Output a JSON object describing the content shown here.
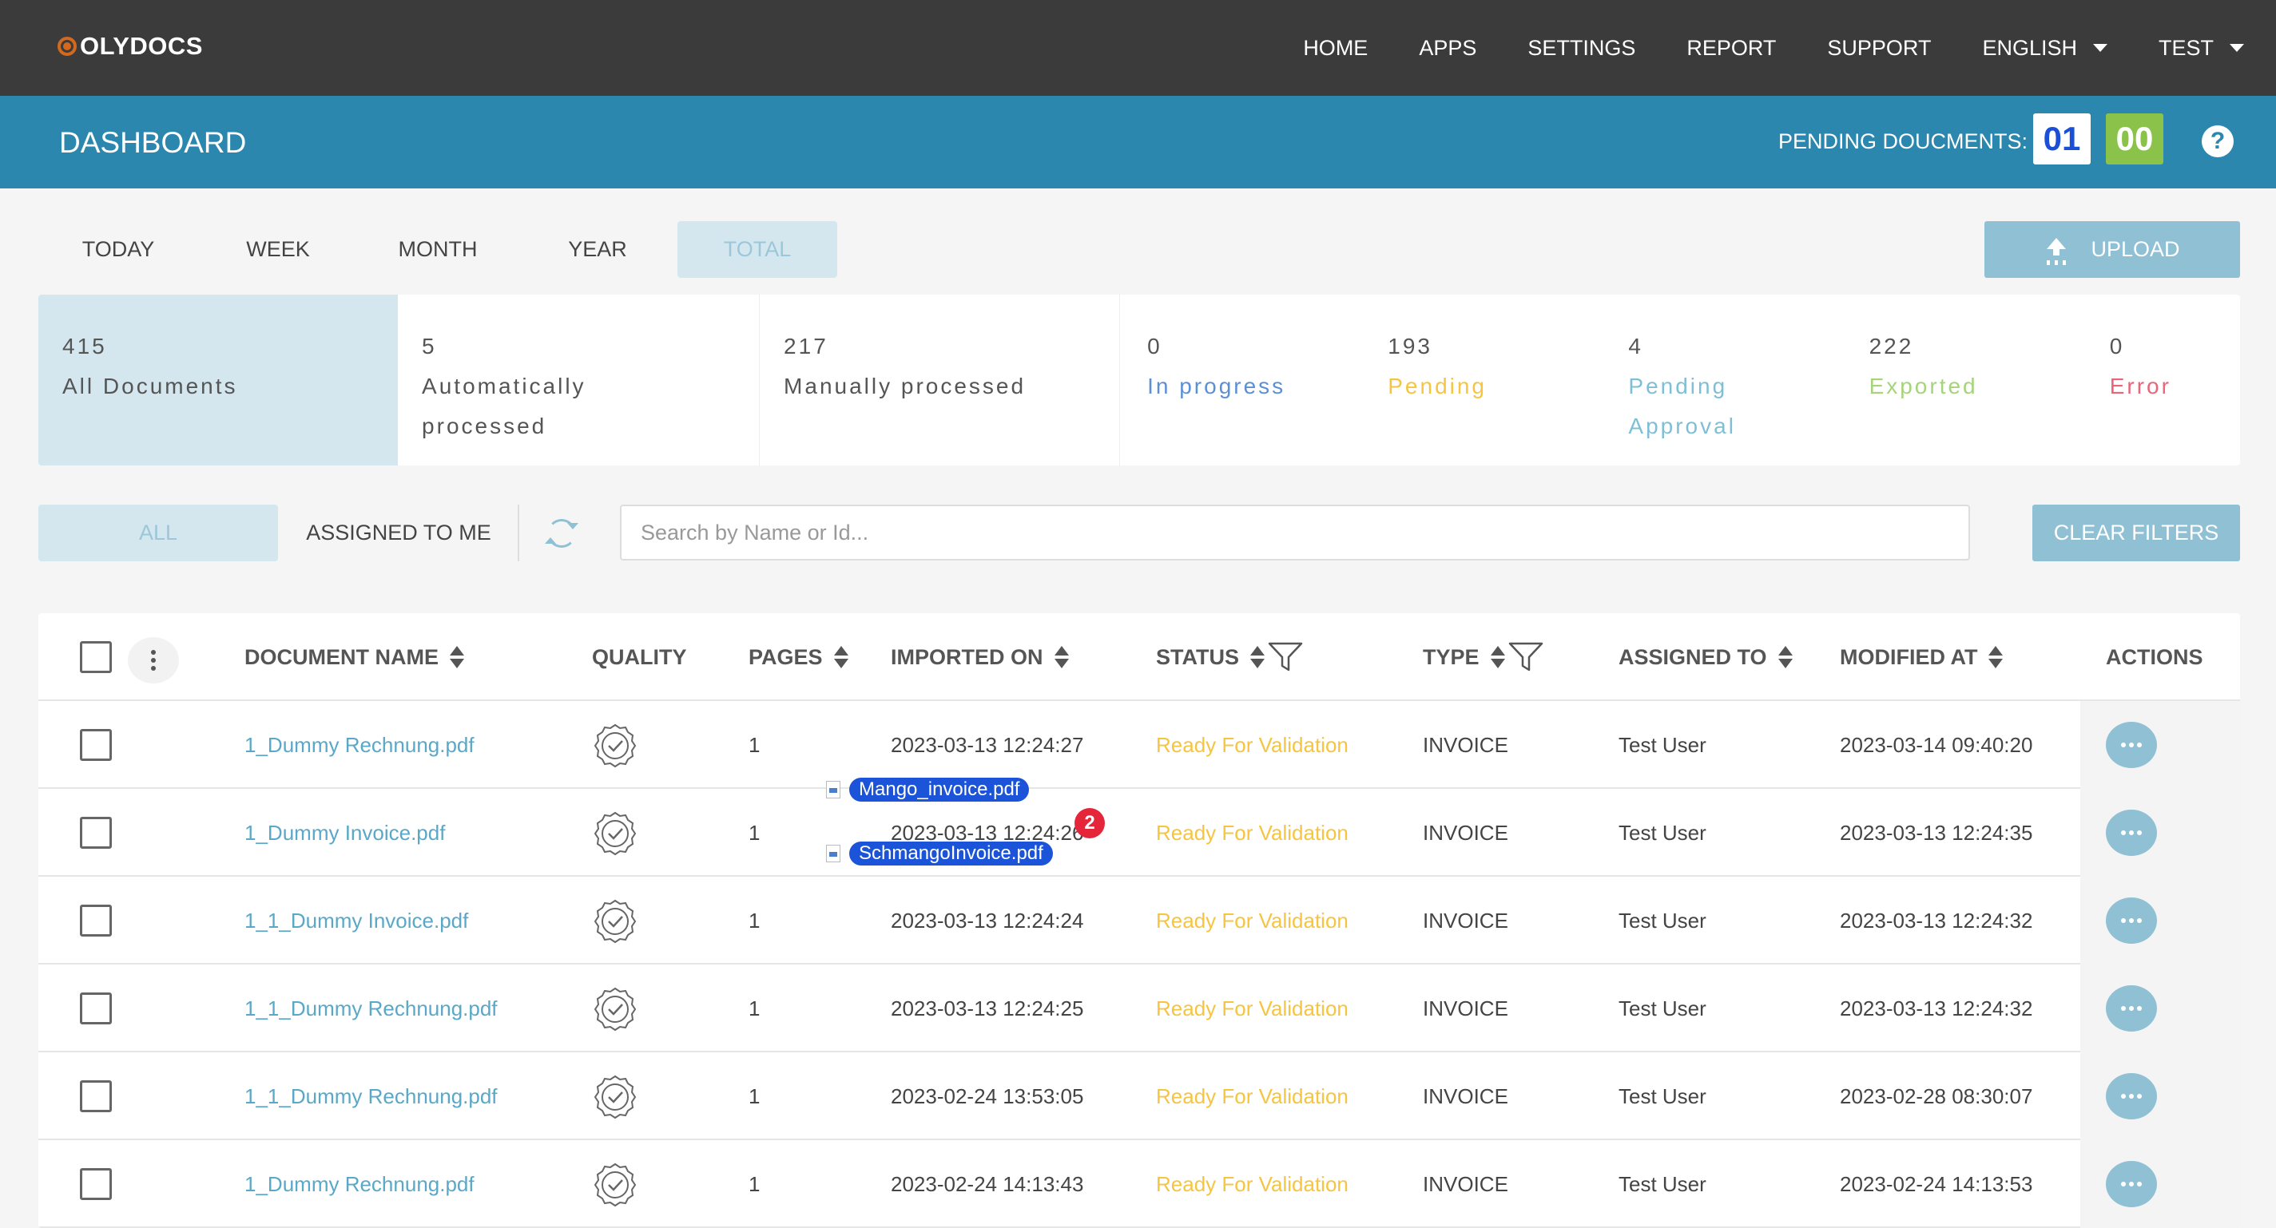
{
  "app": {
    "brand": "OLYDOCS"
  },
  "nav": {
    "items": [
      "HOME",
      "APPS",
      "SETTINGS",
      "REPORT",
      "SUPPORT"
    ],
    "language": "ENGLISH",
    "user": "TEST"
  },
  "dashboard": {
    "title": "DASHBOARD",
    "pending_label": "PENDING DOUCMENTS:",
    "pending_count_a": "01",
    "pending_count_b": "00",
    "help": "?"
  },
  "period_tabs": [
    "TODAY",
    "WEEK",
    "MONTH",
    "YEAR",
    "TOTAL"
  ],
  "active_period": "TOTAL",
  "upload_label": "UPLOAD",
  "stats": [
    {
      "num": "415",
      "label": "All Documents",
      "color": "#555555"
    },
    {
      "num": "5",
      "label": "Automatically processed",
      "color": "#555555"
    },
    {
      "num": "217",
      "label": "Manually processed",
      "color": "#555555"
    },
    {
      "num": "0",
      "label": "In progress",
      "color": "#5b8fd6"
    },
    {
      "num": "193",
      "label": "Pending",
      "color": "#f5c542"
    },
    {
      "num": "4",
      "label": "Pending Approval",
      "color": "#7fbfd6"
    },
    {
      "num": "222",
      "label": "Exported",
      "color": "#a5d47a"
    },
    {
      "num": "0",
      "label": "Error",
      "color": "#e8667a"
    }
  ],
  "filters": {
    "all": "ALL",
    "assigned": "ASSIGNED TO ME",
    "search_placeholder": "Search by Name or Id...",
    "clear": "CLEAR FILTERS"
  },
  "table": {
    "headers": {
      "name": "DOCUMENT NAME",
      "quality": "QUALITY",
      "pages": "PAGES",
      "imported": "IMPORTED ON",
      "status": "STATUS",
      "type": "TYPE",
      "assigned": "ASSIGNED TO",
      "modified": "MODIFIED AT",
      "actions": "ACTIONS"
    },
    "rows": [
      {
        "name": "1_Dummy Rechnung.pdf",
        "pages": "1",
        "imported": "2023-03-13 12:24:27",
        "status": "Ready For Validation",
        "type": "INVOICE",
        "assigned": "Test User",
        "modified": "2023-03-14 09:40:20"
      },
      {
        "name": "1_Dummy Invoice.pdf",
        "pages": "1",
        "imported": "2023-03-13 12:24:26",
        "status": "Ready For Validation",
        "type": "INVOICE",
        "assigned": "Test User",
        "modified": "2023-03-13 12:24:35"
      },
      {
        "name": "1_1_Dummy Invoice.pdf",
        "pages": "1",
        "imported": "2023-03-13 12:24:24",
        "status": "Ready For Validation",
        "type": "INVOICE",
        "assigned": "Test User",
        "modified": "2023-03-13 12:24:32"
      },
      {
        "name": "1_1_Dummy Rechnung.pdf",
        "pages": "1",
        "imported": "2023-03-13 12:24:25",
        "status": "Ready For Validation",
        "type": "INVOICE",
        "assigned": "Test User",
        "modified": "2023-03-13 12:24:32"
      },
      {
        "name": "1_1_Dummy Rechnung.pdf",
        "pages": "1",
        "imported": "2023-02-24 13:53:05",
        "status": "Ready For Validation",
        "type": "INVOICE",
        "assigned": "Test User",
        "modified": "2023-02-28 08:30:07"
      },
      {
        "name": "1_Dummy Rechnung.pdf",
        "pages": "1",
        "imported": "2023-02-24 14:13:43",
        "status": "Ready For Validation",
        "type": "INVOICE",
        "assigned": "Test User",
        "modified": "2023-02-24 14:13:53"
      }
    ]
  },
  "drag": {
    "files": [
      "Mango_invoice.pdf",
      "SchmangoInvoice.pdf"
    ],
    "count": "2"
  }
}
